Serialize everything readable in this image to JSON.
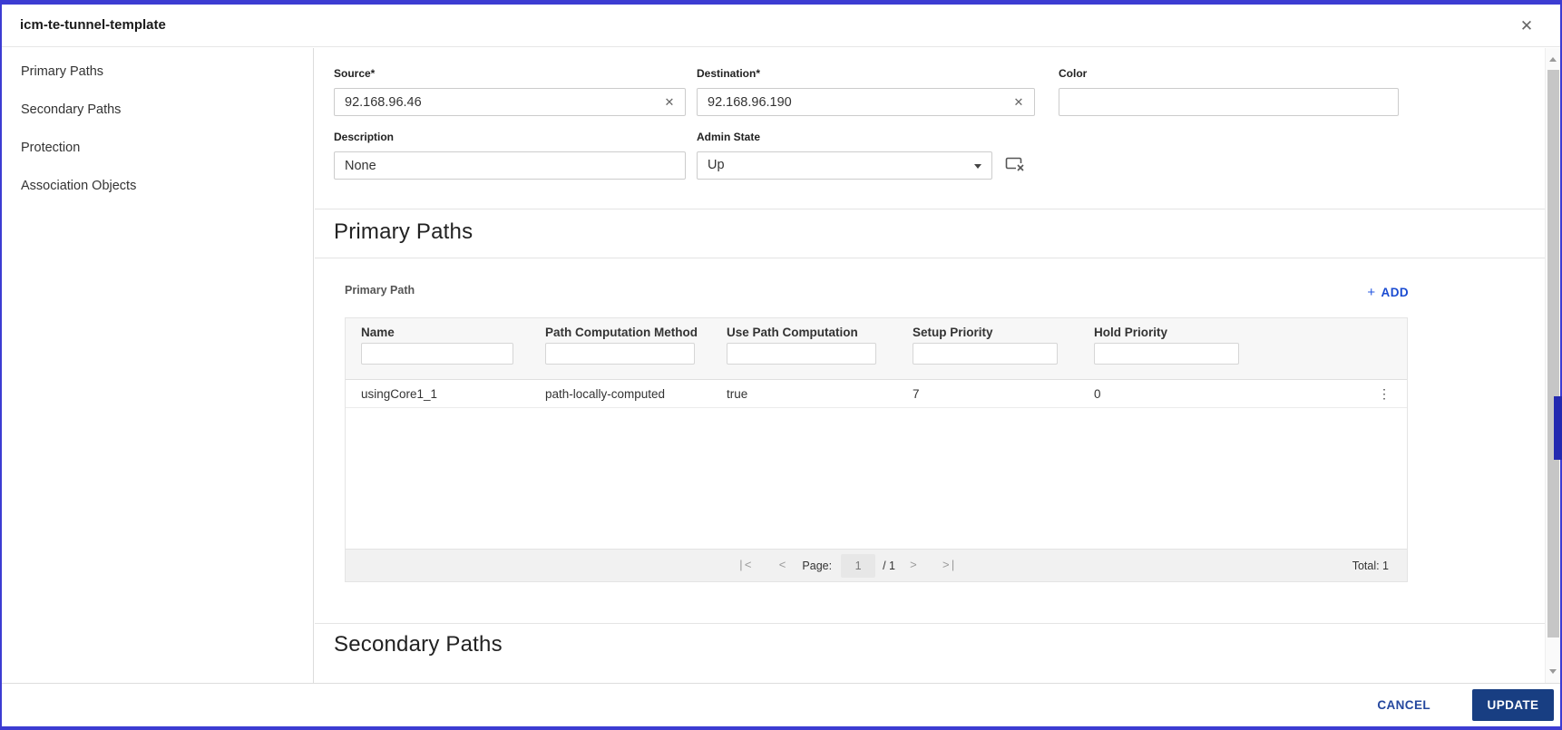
{
  "window": {
    "title": "icm-te-tunnel-template"
  },
  "icons": {
    "close": "✕",
    "clear": "✕",
    "kebab": "⋮"
  },
  "sidebar": {
    "items": [
      {
        "label": "Primary Paths"
      },
      {
        "label": "Secondary Paths"
      },
      {
        "label": "Protection"
      },
      {
        "label": "Association Objects"
      }
    ]
  },
  "form": {
    "source": {
      "label": "Source*",
      "value": "92.168.96.46"
    },
    "destination": {
      "label": "Destination*",
      "value": "92.168.96.190"
    },
    "color": {
      "label": "Color",
      "value": ""
    },
    "description": {
      "label": "Description",
      "value": "None"
    },
    "admin_state": {
      "label": "Admin State",
      "value": "Up"
    }
  },
  "primary_paths": {
    "heading": "Primary Paths",
    "table_label": "Primary Path",
    "add_plus": "+",
    "add_label": "ADD",
    "columns": {
      "name": "Name",
      "path_computation_method": "Path Computation Method",
      "use_path_computation": "Use Path Computation",
      "setup_priority": "Setup Priority",
      "hold_priority": "Hold Priority"
    },
    "rows": [
      {
        "name": "usingCore1_1",
        "path_computation_method": "path-locally-computed",
        "use_path_computation": "true",
        "setup_priority": "7",
        "hold_priority": "0"
      }
    ],
    "pagination": {
      "first": "|<",
      "prev": "<",
      "page_label": "Page:",
      "page_value": "1",
      "page_of": "/ 1",
      "next": ">",
      "last": ">|",
      "total": "Total: 1"
    }
  },
  "secondary_paths": {
    "heading": "Secondary Paths"
  },
  "footer": {
    "cancel": "CANCEL",
    "update": "UPDATE"
  },
  "colors": {
    "frame": "#3c3cd2",
    "accent_blue": "#1a4bd1",
    "update_bg": "#183e82",
    "cancel_text": "#24479e"
  }
}
